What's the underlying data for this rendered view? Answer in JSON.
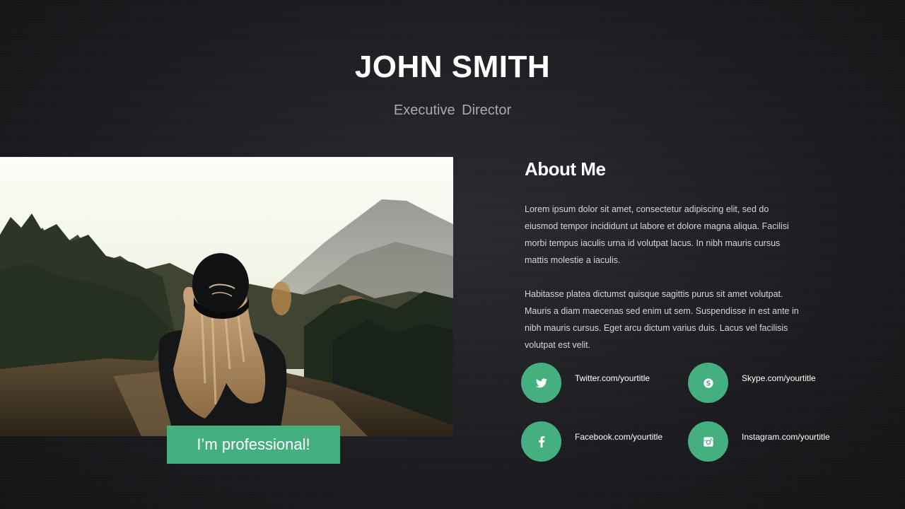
{
  "header": {
    "name": "JOHN SMITH",
    "role": "Executive  Director"
  },
  "photo": {
    "badge_text": "I’m professional!"
  },
  "about": {
    "heading": "About Me",
    "paragraphs": [
      "Lorem ipsum dolor sit amet, consectetur adipiscing elit, sed do eiusmod tempor incididunt ut labore et dolore magna aliqua. Facilisi morbi tempus iaculis urna id volutpat lacus. In nibh mauris cursus mattis molestie a iaculis.",
      "Habitasse platea dictumst quisque sagittis purus sit amet volutpat. Mauris a diam maecenas sed enim ut sem. Suspendisse in est ante in nibh mauris cursus. Eget arcu dictum varius duis. Lacus vel facilisis volutpat est velit."
    ]
  },
  "social": [
    {
      "icon": "twitter-icon",
      "label": "Twitter.com/yourtitle"
    },
    {
      "icon": "skype-icon",
      "label": "Skype.com/yourtitle"
    },
    {
      "icon": "facebook-icon",
      "label": "Facebook.com/yourtitle"
    },
    {
      "icon": "instagram-icon",
      "label": "Instagram.com/yourtitle"
    }
  ],
  "colors": {
    "accent": "#45b07f",
    "background": "#1d1d22",
    "heading": "#ffffff",
    "subtitle": "#a9a9ad"
  }
}
